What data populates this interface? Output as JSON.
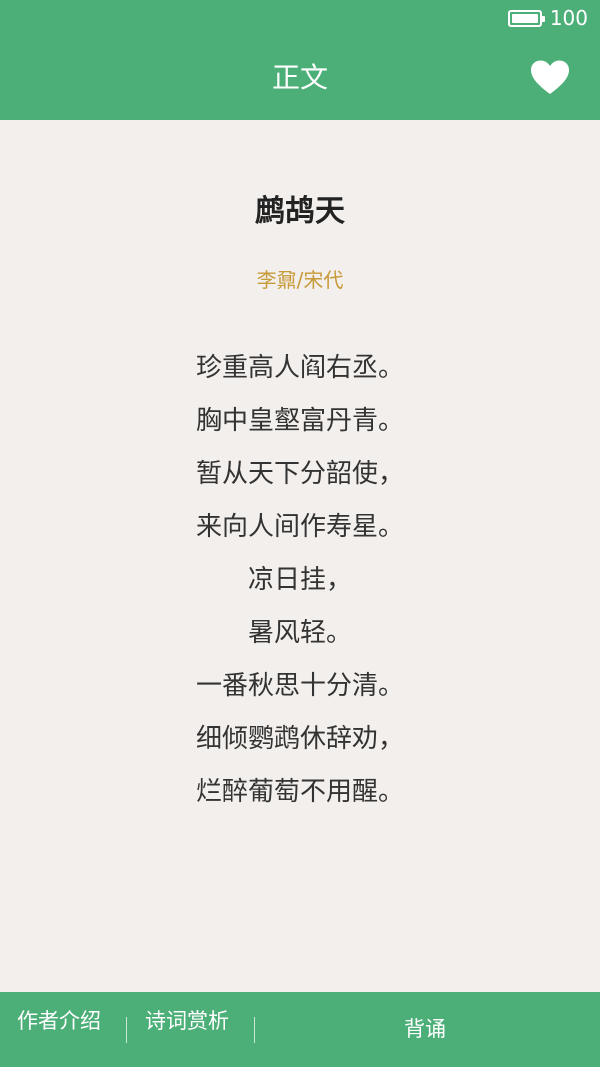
{
  "status": {
    "battery_level": 100,
    "battery_text": "100"
  },
  "header": {
    "title": "正文",
    "favorite_icon": "heart-icon"
  },
  "poem": {
    "title": "鹧鸪天",
    "author_line": "李鼐/宋代",
    "lines": [
      "珍重高人阎右丞。",
      "胸中皇壑富丹青。",
      "暂从天下分韶使，",
      "来向人间作寿星。",
      "凉日挂，",
      "暑风轻。",
      "一番秋思十分清。",
      "细倾鹦鹉休辞劝，",
      "烂醉葡萄不用醒。"
    ]
  },
  "footer": {
    "author_intro_label": "作者介绍",
    "appreciation_label": "诗词赏析",
    "recite_label": "背诵"
  },
  "colors": {
    "accent": "#4caf78",
    "background": "#f3efec",
    "author_text": "#c79a3a"
  }
}
